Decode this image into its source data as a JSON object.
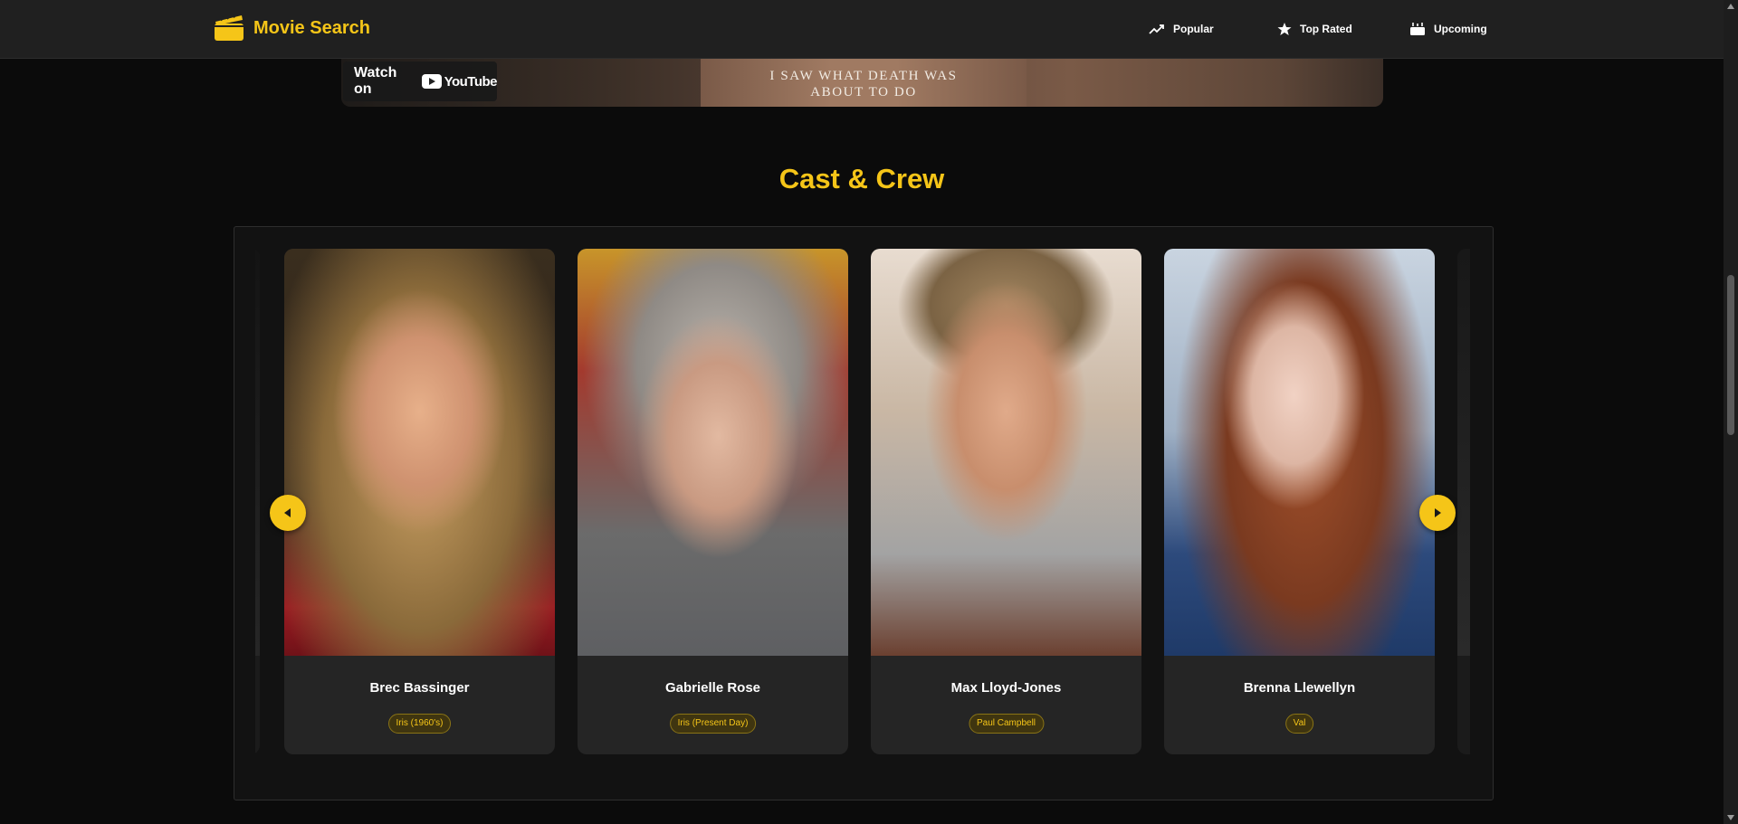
{
  "header": {
    "brand_title": "Movie Search",
    "brand_icon": "clapperboard-icon",
    "nav": [
      {
        "label": "Popular",
        "icon": "trending-up-icon"
      },
      {
        "label": "Top Rated",
        "icon": "star-icon"
      },
      {
        "label": "Upcoming",
        "icon": "calendar-icon"
      }
    ]
  },
  "trailer": {
    "watch_label": "Watch on",
    "youtube_label": "YouTube",
    "tagline_line1": "I SAW WHAT DEATH WAS",
    "tagline_line2": "ABOUT TO DO"
  },
  "cast_section": {
    "title": "Cast & Crew",
    "cast": [
      {
        "name": "Brec Bassinger",
        "role": "Iris (1960's)"
      },
      {
        "name": "Gabrielle Rose",
        "role": "Iris (Present Day)"
      },
      {
        "name": "Max Lloyd-Jones",
        "role": "Paul Campbell"
      },
      {
        "name": "Brenna Llewellyn",
        "role": "Val"
      }
    ]
  },
  "colors": {
    "accent": "#f5c518",
    "background": "#0b0b0b",
    "card": "#252525"
  }
}
